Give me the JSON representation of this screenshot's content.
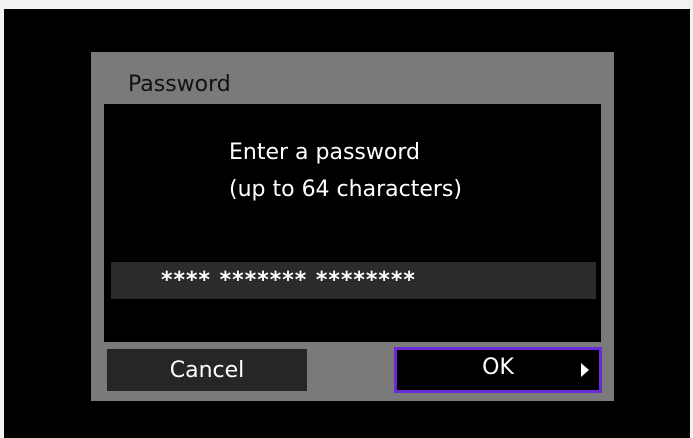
{
  "dialog": {
    "title": "Password",
    "message_line1": "Enter a password",
    "message_line2": "(up to 64 characters)",
    "password_value": "**** ******* ********",
    "cancel_label": "Cancel",
    "ok_label": "OK"
  },
  "icons": {
    "ok_arrow": "right-arrow-icon"
  },
  "colors": {
    "screen_background": "#000000",
    "dialog_background": "#7a7a7a",
    "button_background": "#262626",
    "focus_border": "#6a2ad8",
    "text": "#ffffff"
  }
}
